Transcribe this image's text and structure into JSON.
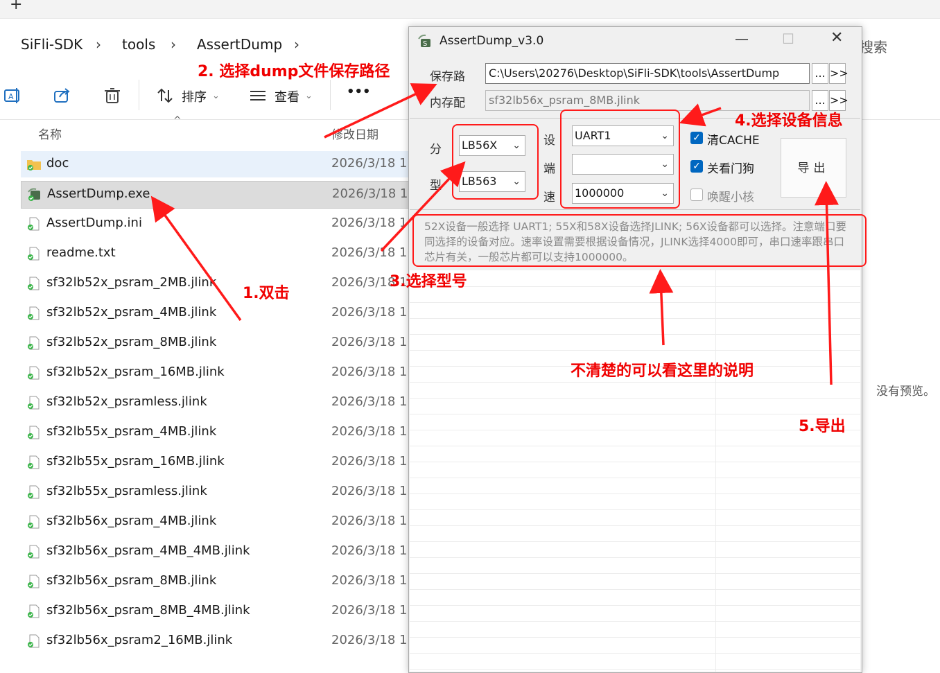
{
  "explorer": {
    "breadcrumb": [
      "SiFli-SDK",
      "tools",
      "AssertDump"
    ],
    "search_text": "搜索",
    "toolbar": {
      "sort_label": "排序",
      "view_label": "查看",
      "more_label": "•••"
    },
    "columns": {
      "name": "名称",
      "date": "修改日期"
    },
    "files": [
      {
        "name": "doc",
        "date": "2026/3/18 1",
        "icon": "folder-icon"
      },
      {
        "name": "AssertDump.exe",
        "date": "2026/3/18 1",
        "icon": "exe-icon"
      },
      {
        "name": "AssertDump.ini",
        "date": "2026/3/18 1",
        "icon": "file-icon"
      },
      {
        "name": "readme.txt",
        "date": "2026/3/18 1",
        "icon": "file-icon"
      },
      {
        "name": "sf32lb52x_psram_2MB.jlink",
        "date": "2026/3/18 1",
        "icon": "file-icon"
      },
      {
        "name": "sf32lb52x_psram_4MB.jlink",
        "date": "2026/3/18 1",
        "icon": "file-icon"
      },
      {
        "name": "sf32lb52x_psram_8MB.jlink",
        "date": "2026/3/18 1",
        "icon": "file-icon"
      },
      {
        "name": "sf32lb52x_psram_16MB.jlink",
        "date": "2026/3/18 1",
        "icon": "file-icon"
      },
      {
        "name": "sf32lb52x_psramless.jlink",
        "date": "2026/3/18 1",
        "icon": "file-icon"
      },
      {
        "name": "sf32lb55x_psram_4MB.jlink",
        "date": "2026/3/18 1",
        "icon": "file-icon"
      },
      {
        "name": "sf32lb55x_psram_16MB.jlink",
        "date": "2026/3/18 1",
        "icon": "file-icon"
      },
      {
        "name": "sf32lb55x_psramless.jlink",
        "date": "2026/3/18 1",
        "icon": "file-icon"
      },
      {
        "name": "sf32lb56x_psram_4MB.jlink",
        "date": "2026/3/18 1",
        "icon": "file-icon"
      },
      {
        "name": "sf32lb56x_psram_4MB_4MB.jlink",
        "date": "2026/3/18 1",
        "icon": "file-icon"
      },
      {
        "name": "sf32lb56x_psram_8MB.jlink",
        "date": "2026/3/18 1",
        "icon": "file-icon"
      },
      {
        "name": "sf32lb56x_psram_8MB_4MB.jlink",
        "date": "2026/3/18 1",
        "icon": "file-icon"
      },
      {
        "name": "sf32lb56x_psram2_16MB.jlink",
        "date": "2026/3/18 1",
        "icon": "file-icon"
      }
    ],
    "preview_text": "没有预览。"
  },
  "app": {
    "title": "AssertDump_v3.0",
    "save_path_label": "保存路",
    "save_path_value": "C:\\Users\\20276\\Desktop\\SiFli-SDK\\tools\\AssertDump",
    "memory_label": "内存配",
    "memory_value": "sf32lb56x_psram_8MB.jlink",
    "browse_label": "...",
    "next_label": ">>",
    "series_label": "分",
    "model_label": "型",
    "series_value": "LB56X",
    "model_value": "LB563",
    "device_label": "设",
    "port_label": "端",
    "speed_label": "速",
    "device_value": "UART1",
    "port_value": "",
    "speed_value": "1000000",
    "checks": [
      {
        "label": "清CACHE",
        "checked": true
      },
      {
        "label": "关看门狗",
        "checked": true
      },
      {
        "label": "唤醒小核",
        "checked": false
      }
    ],
    "export_label": "导出",
    "info_text": "52X设备一般选择 UART1; 55X和58X设备选择JLINK; 56X设备都可以选择。注意端口要同选择的设备对应。速率设置需要根据设备情况，JLINK选择4000即可，串口速率跟串口芯片有关，一般芯片都可以支持1000000。"
  },
  "annotations": {
    "step1": "1.双击",
    "step2": "2. 选择dump文件保存路径",
    "step3": "3.选择型号",
    "step4": "4.选择设备信息",
    "step5": "5.导出",
    "note": "不清楚的可以看这里的说明"
  },
  "colors": {
    "annotation": "#f00000",
    "checkbox": "#0067c0",
    "selection": "#dcdcdc"
  }
}
